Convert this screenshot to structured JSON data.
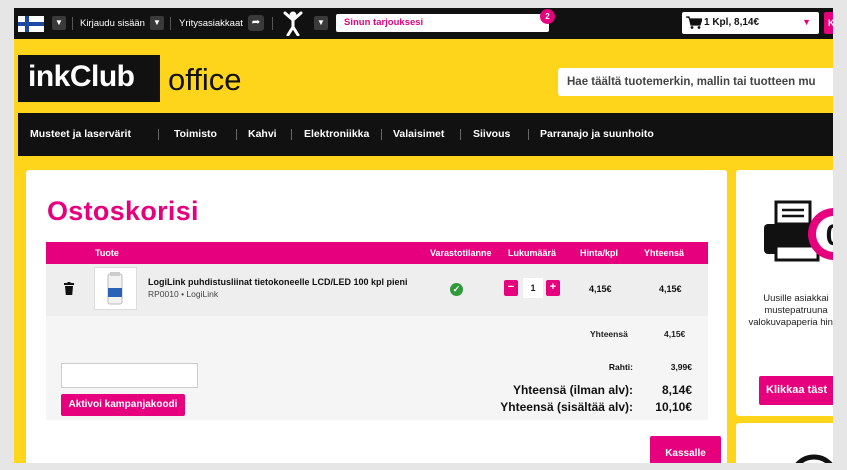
{
  "topbar": {
    "login_label": "Kirjaudu sisään",
    "business_label": "Yritysasiakkaat",
    "offers_label": "Sinun tarjouksesi",
    "offers_count": "2",
    "cart_summary": "1 Kpl, 8,14€",
    "cart_button_label": "K"
  },
  "header": {
    "logo_text": "inkClub",
    "logo_suffix": "office",
    "search_placeholder": "Hae täältä tuotemerkin, mallin tai tuotteen mu"
  },
  "nav": {
    "items": [
      {
        "label": "Musteet ja laservärit"
      },
      {
        "label": "Toimisto"
      },
      {
        "label": "Kahvi"
      },
      {
        "label": "Elektroniikka"
      },
      {
        "label": "Valaisimet"
      },
      {
        "label": "Siivous"
      },
      {
        "label": "Parranajo ja suunhoito"
      }
    ]
  },
  "cart": {
    "title": "Ostoskorisi",
    "columns": {
      "product": "Tuote",
      "stock": "Varastotilanne",
      "quantity": "Lukumäärä",
      "unit_price": "Hinta/kpl",
      "total": "Yhteensä"
    },
    "items": [
      {
        "name": "LogiLink puhdistusliinat tietokoneelle LCD/LED 100 kpl pieni",
        "sku": "RP0010 • LogiLink",
        "quantity": "1",
        "unit_price": "4,15€",
        "total": "4,15€"
      }
    ],
    "subtotal_label": "Yhteensä",
    "subtotal_value": "4,15€",
    "shipping_label": "Rahti:",
    "shipping_value": "3,99€",
    "total_excl_label": "Yhteensä (ilman alv):",
    "total_excl_value": "8,14€",
    "total_incl_label": "Yhteensä (sisältää alv):",
    "total_incl_value": "10,10€",
    "coupon_button": "Aktivoi kampanjakoodi",
    "checkout_button": "Kassalle"
  },
  "sidebar": {
    "promo_text": "Uusille asiakkai mustepatruuna valokuvapaperia hin €!",
    "promo_button": "Klikkaa täst"
  },
  "colors": {
    "accent": "#e6007e",
    "brand_yellow": "#ffd51c",
    "dark": "#111111",
    "stock_ok": "#2e9a3a"
  }
}
